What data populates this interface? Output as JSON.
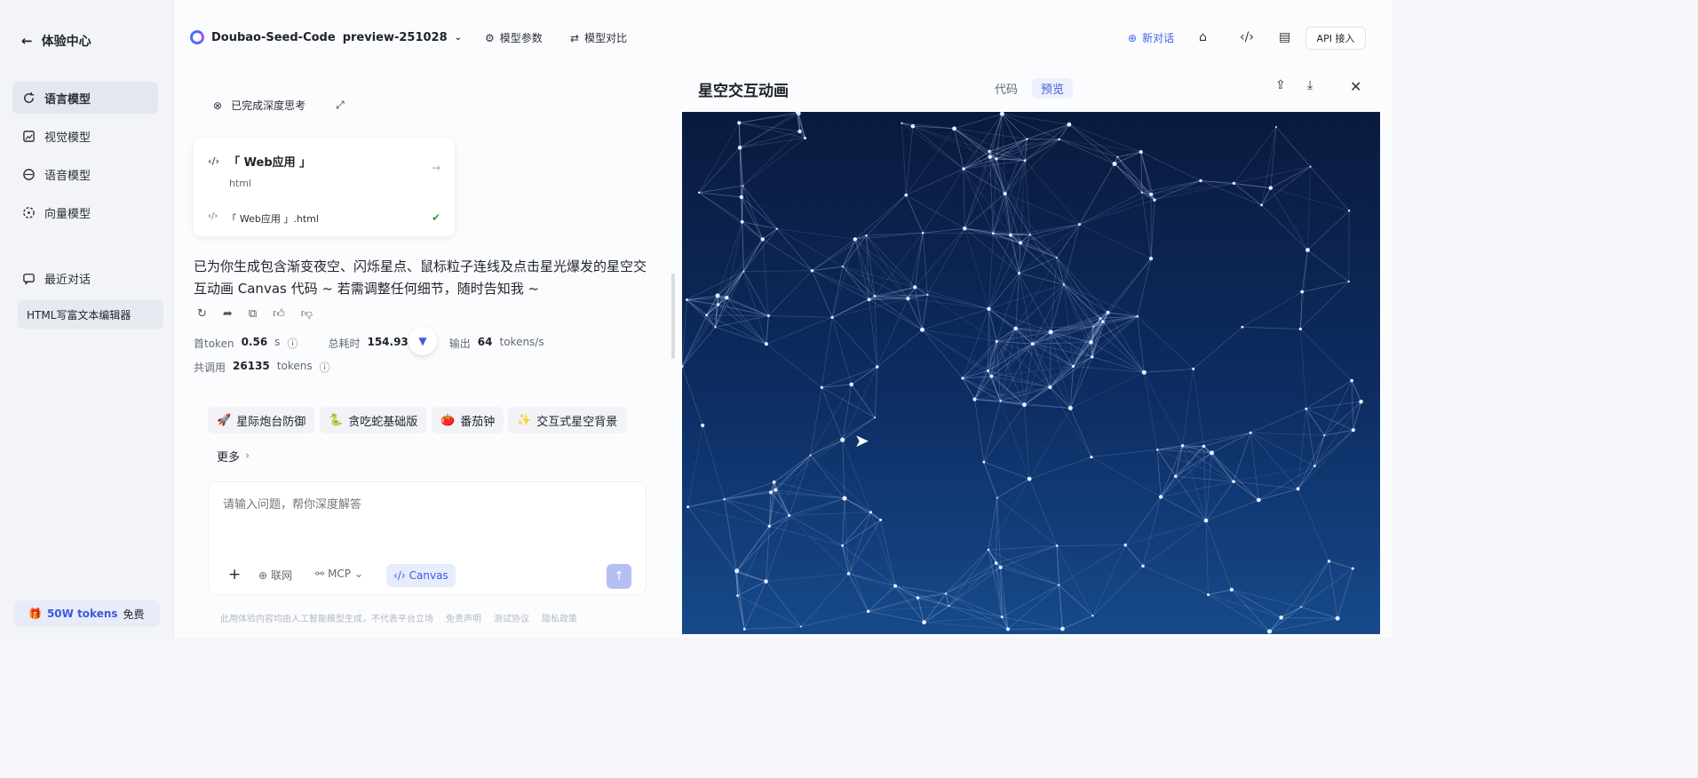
{
  "sidebar": {
    "back_label": "体验中心",
    "items": [
      {
        "label": "语言模型",
        "icon": "refresh-icon",
        "active": true
      },
      {
        "label": "视觉模型",
        "icon": "image-icon"
      },
      {
        "label": "语音模型",
        "icon": "voice-icon"
      },
      {
        "label": "向量模型",
        "icon": "vector-icon"
      }
    ],
    "recent_label": "最近对话",
    "recent_items": [
      "HTML写富文本编辑器"
    ],
    "promo": {
      "highlight": "50W tokens",
      "text": "免费"
    }
  },
  "topbar": {
    "model_name": "Doubao-Seed-Code",
    "model_version": "preview-251028",
    "params_label": "模型参数",
    "compare_label": "模型对比",
    "new_chat_label": "新对话",
    "api_label": "API 接入"
  },
  "chat": {
    "think_label": "已完成深度思考",
    "card": {
      "title": "「 Web应用 」",
      "subtitle": "html",
      "file": "「 Web应用 」.html"
    },
    "answer": "已为你生成包含渐变夜空、闪烁星点、鼠标粒子连线及点击星光爆发的星空交互动画 Canvas 代码 ~ 若需调整任何细节，随时告知我 ~",
    "stats": {
      "first_token_label": "首token",
      "first_token_value": "0.56",
      "first_token_unit": "s",
      "total_time_label": "总耗时",
      "total_time_value": "154.93",
      "output_label": "输出",
      "output_value": "64",
      "output_unit": "tokens/s",
      "total_label": "共调用",
      "total_value": "26135",
      "total_unit": "tokens"
    },
    "suggestions": [
      "星际炮台防御",
      "贪吃蛇基础版",
      "番茄钟",
      "交互式星空背景"
    ],
    "more_label": "更多",
    "input_placeholder": "请输入问题，帮你深度解答",
    "tools": {
      "web": "联网",
      "mcp": "MCP",
      "canvas": "Canvas"
    },
    "disclaimer": [
      "此用体验内容均由人工智能模型生成，不代表平台立场",
      "免责声明",
      "测试协议",
      "隐私政策"
    ]
  },
  "preview": {
    "title": "星空交互动画",
    "tabs": [
      {
        "label": "代码"
      },
      {
        "label": "预览",
        "active": true
      }
    ]
  }
}
